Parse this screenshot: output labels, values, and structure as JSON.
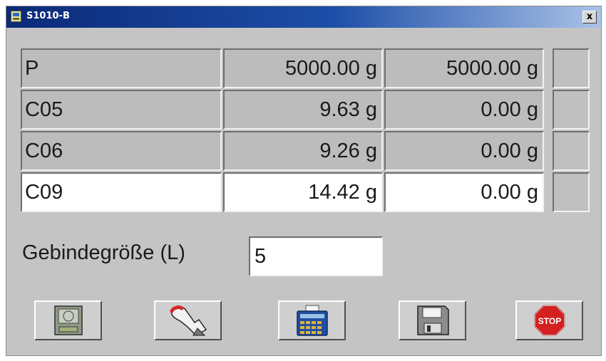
{
  "window": {
    "title": "S1010-B",
    "close_label": "x"
  },
  "table": {
    "rows": [
      {
        "name": "P",
        "value1": "5000.00 g",
        "value2": "5000.00 g",
        "highlight": false
      },
      {
        "name": "C05",
        "value1": "9.63 g",
        "value2": "0.00 g",
        "highlight": false
      },
      {
        "name": "C06",
        "value1": "9.26 g",
        "value2": "0.00 g",
        "highlight": false
      },
      {
        "name": "C09",
        "value1": "14.42 g",
        "value2": "0.00 g",
        "highlight": true
      }
    ]
  },
  "container_size": {
    "label": "Gebindegröße (L)",
    "value": "5"
  },
  "toolbar": {
    "buttons": [
      {
        "name": "scale-button",
        "icon": "scale-icon"
      },
      {
        "name": "manual-dose-button",
        "icon": "hand-pointer-icon"
      },
      {
        "name": "calculator-button",
        "icon": "calculator-icon"
      },
      {
        "name": "save-button",
        "icon": "floppy-disk-icon"
      },
      {
        "name": "stop-button",
        "icon": "stop-sign-icon",
        "label": "STOP"
      }
    ]
  },
  "colors": {
    "titlebar": "#0b2a78",
    "window_bg": "#c4c4c4",
    "stop_red": "#d42020"
  }
}
